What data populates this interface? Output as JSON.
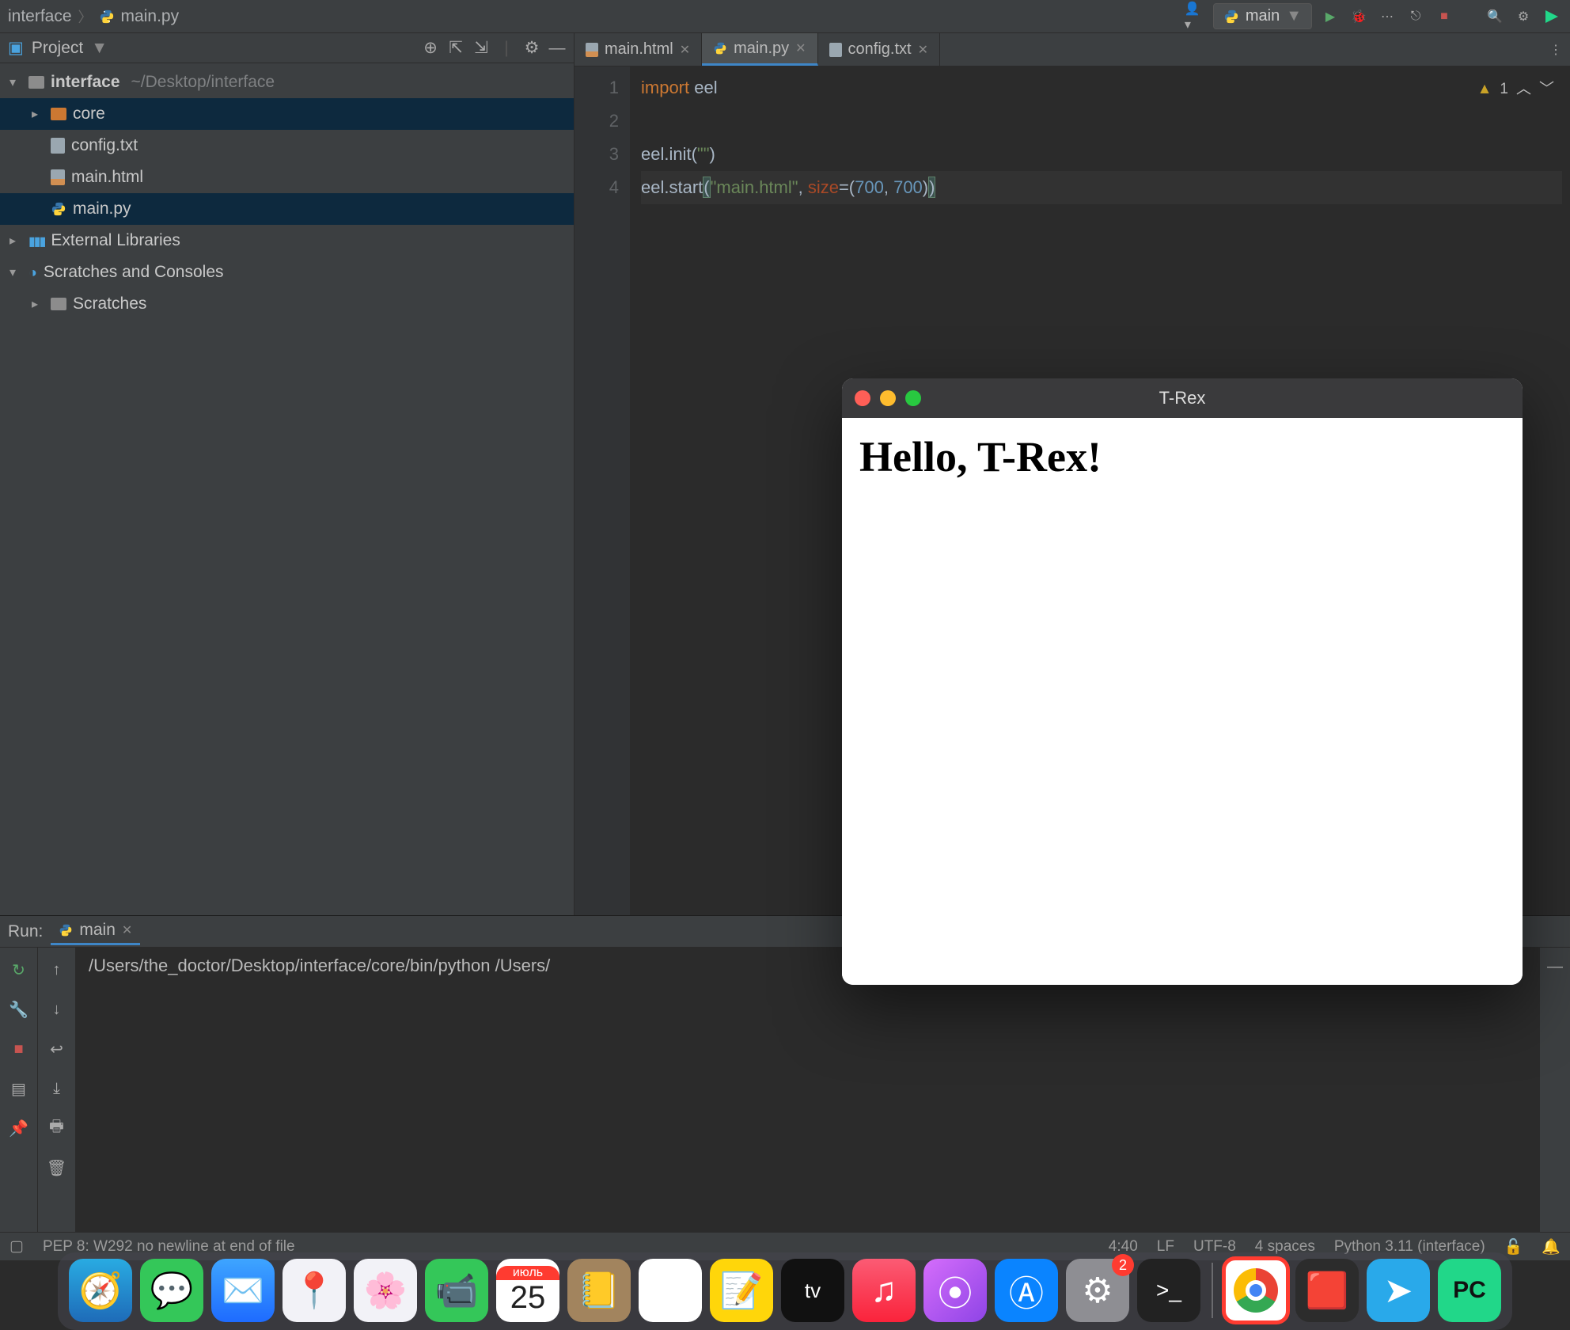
{
  "breadcrumb": {
    "project": "interface",
    "file": "main.py"
  },
  "run_config": {
    "label": "main"
  },
  "sidebar": {
    "title": "Project",
    "items": [
      {
        "kind": "project",
        "label": "interface",
        "path": "~/Desktop/interface",
        "expanded": true,
        "depth": 0
      },
      {
        "kind": "folder",
        "label": "core",
        "expanded": false,
        "depth": 1,
        "selectedDir": true
      },
      {
        "kind": "file-txt",
        "label": "config.txt",
        "depth": 1
      },
      {
        "kind": "file-html",
        "label": "main.html",
        "depth": 1
      },
      {
        "kind": "file-py",
        "label": "main.py",
        "depth": 1,
        "selectedFile": true
      },
      {
        "kind": "lib",
        "label": "External Libraries",
        "expanded": false,
        "depth": 0
      },
      {
        "kind": "scratch-root",
        "label": "Scratches and Consoles",
        "expanded": true,
        "depth": 0
      },
      {
        "kind": "folder-grey",
        "label": "Scratches",
        "expanded": false,
        "depth": 1
      }
    ]
  },
  "tabs": [
    {
      "label": "main.html",
      "icon": "html",
      "active": false
    },
    {
      "label": "main.py",
      "icon": "py",
      "active": true
    },
    {
      "label": "config.txt",
      "icon": "txt",
      "active": false
    }
  ],
  "inspection": {
    "warnings": "1"
  },
  "code": {
    "lines": [
      "1",
      "2",
      "3",
      "4"
    ],
    "l1_kw": "import",
    "l1_id": " eel",
    "l3_a": "eel",
    "l3_b": ".init(",
    "l3_str": "\"\"",
    "l3_c": ")",
    "l4_a": "eel",
    "l4_b": ".start",
    "l4_lp": "(",
    "l4_str": "\"main.html\"",
    "l4_comma": ", ",
    "l4_param": "size",
    "l4_eq": "=(",
    "l4_n1": "700",
    "l4_c2": ", ",
    "l4_n2": "700",
    "l4_rp1": ")",
    "l4_rp2": ")"
  },
  "run": {
    "label": "Run:",
    "tab": "main",
    "output": "/Users/the_doctor/Desktop/interface/core/bin/python /Users/"
  },
  "status": {
    "hint": "PEP 8: W292 no newline at end of file",
    "pos": "4:40",
    "lf": "LF",
    "enc": "UTF-8",
    "indent": "4 spaces",
    "interp": "Python 3.11 (interface)"
  },
  "float": {
    "title": "T-Rex",
    "heading": "Hello, T-Rex!"
  },
  "dock": {
    "cal_month": "июль",
    "cal_day": "25",
    "badge": "2",
    "pc_label": "PC"
  }
}
